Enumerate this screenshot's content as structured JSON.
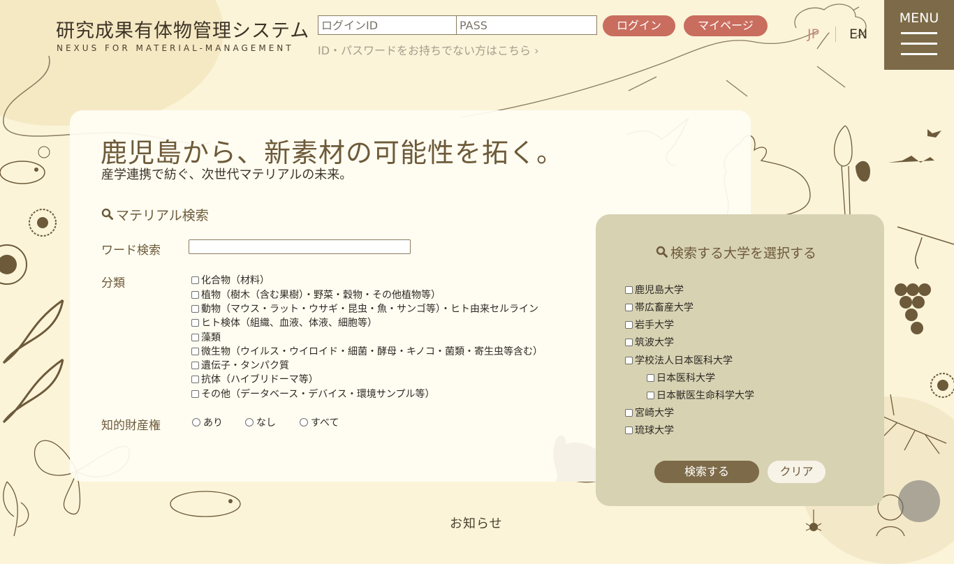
{
  "header": {
    "title": "研究成果有体物管理システム",
    "subtitle": "NEXUS FOR MATERIAL-MANAGEMENT",
    "login_id_placeholder": "ログインID",
    "pass_placeholder": "PASS",
    "login_label": "ログイン",
    "mypage_label": "マイページ",
    "no_account_link": "ID・パスワードをお持ちでない方はこちら ›",
    "lang_jp": "JP",
    "lang_en": "EN",
    "menu_label": "MENU"
  },
  "hero": {
    "headline": "鹿児島から、新素材の可能性を拓く。",
    "subline": "産学連携で紡ぐ、次世代マテリアルの未来。"
  },
  "search": {
    "section_title": "マテリアル検索",
    "word_label": "ワード検索",
    "word_value": "",
    "category_label": "分類",
    "categories": [
      "化合物（材料）",
      "植物（樹木（含む果樹）・野菜・穀物・その他植物等）",
      "動物（マウス・ラット・ウサギ・昆虫・魚・サンゴ等）・ヒト由来セルライン",
      "ヒト検体（組織、血液、体液、細胞等）",
      "藻類",
      "微生物（ウイルス・ウイロイド・細菌・酵母・キノコ・菌類・寄生虫等含む）",
      "遺伝子・タンパク質",
      "抗体（ハイブリドーマ等）",
      "その他（データベース・デバイス・環境サンプル等）"
    ],
    "ip_label": "知的財産権",
    "ip_options": [
      "あり",
      "なし",
      "すべて"
    ]
  },
  "universities": {
    "title": "検索する大学を選択する",
    "items": [
      "鹿児島大学",
      "帯広畜産大学",
      "岩手大学",
      "筑波大学",
      "学校法人日本医科大学",
      "日本医科大学",
      "日本獣医生命科学大学",
      "宮崎大学",
      "琉球大学"
    ],
    "search_button": "検索する",
    "clear_button": "クリア"
  },
  "footer": {
    "notice": "お知らせ"
  }
}
